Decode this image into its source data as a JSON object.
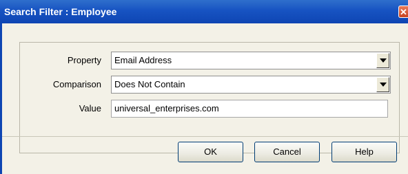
{
  "window": {
    "title": "Search Filter : Employee",
    "close_glyph": "✕"
  },
  "form": {
    "property": {
      "label": "Property",
      "value": "Email Address"
    },
    "comparison": {
      "label": "Comparison",
      "value": "Does Not Contain"
    },
    "value": {
      "label": "Value",
      "value": "universal_enterprises.com"
    }
  },
  "buttons": {
    "ok": "OK",
    "cancel": "Cancel",
    "help": "Help"
  },
  "icons": {
    "close": "close-icon",
    "dropdown": "chevron-down-icon"
  },
  "colors": {
    "titlebar": "#1753c2",
    "dialog_background": "#f3f1e7",
    "button_border": "#003c74"
  }
}
